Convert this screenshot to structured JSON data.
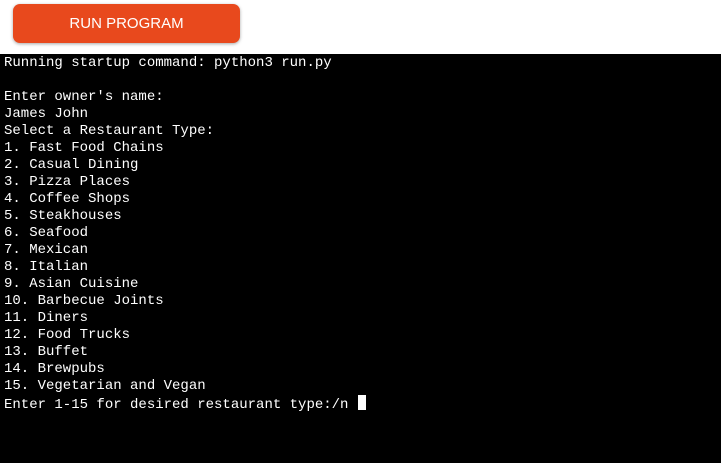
{
  "toolbar": {
    "run_label": "RUN PROGRAM"
  },
  "terminal": {
    "startup": "Running startup command: python3 run.py",
    "owner_prompt": "Enter owner's name:",
    "owner_value": "James John",
    "type_prompt": "Select a Restaurant Type:",
    "options": [
      "1. Fast Food Chains",
      "2. Casual Dining",
      "3. Pizza Places",
      "4. Coffee Shops",
      "5. Steakhouses",
      "6. Seafood",
      "7. Mexican",
      "8. Italian",
      "9. Asian Cuisine",
      "10. Barbecue Joints",
      "11. Diners",
      "12. Food Trucks",
      "13. Buffet",
      "14. Brewpubs",
      "15. Vegetarian and Vegan"
    ],
    "input_prompt": "Enter 1-15 for desired restaurant type:/n "
  },
  "colors": {
    "button_bg": "#e8491d",
    "terminal_bg": "#000000",
    "terminal_fg": "#ffffff"
  }
}
